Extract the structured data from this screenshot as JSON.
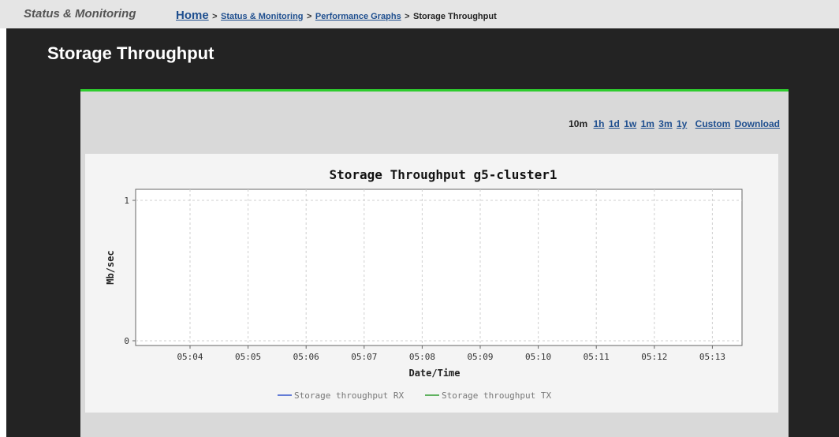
{
  "header": {
    "section_title": "Status & Monitoring",
    "breadcrumb": {
      "home": "Home",
      "separator": ">",
      "items": [
        "Status & Monitoring",
        "Performance Graphs"
      ],
      "current": "Storage Throughput"
    }
  },
  "page": {
    "title": "Storage Throughput"
  },
  "time_range": {
    "current": "10m",
    "links": [
      "1h",
      "1d",
      "1w",
      "1m",
      "3m",
      "1y"
    ],
    "custom_label": "Custom",
    "download_label": "Download"
  },
  "colors": {
    "accent_green": "#2ecc2e",
    "link_blue": "#1f4f8f",
    "rx_series": "#3355cc",
    "tx_series": "#2e9b2e"
  },
  "chart_data": {
    "type": "line",
    "title": "Storage Throughput g5-cluster1",
    "xlabel": "Date/Time",
    "ylabel": "Mb/sec",
    "x_ticks": [
      "05:04",
      "05:05",
      "05:06",
      "05:07",
      "05:08",
      "05:09",
      "05:10",
      "05:11",
      "05:12",
      "05:13"
    ],
    "y_ticks": [
      0,
      1
    ],
    "ylim": [
      0,
      1
    ],
    "grid": true,
    "legend_position": "bottom",
    "series": [
      {
        "name": "Storage throughput RX",
        "color": "#3355cc",
        "values": []
      },
      {
        "name": "Storage throughput TX",
        "color": "#2e9b2e",
        "values": []
      }
    ]
  }
}
